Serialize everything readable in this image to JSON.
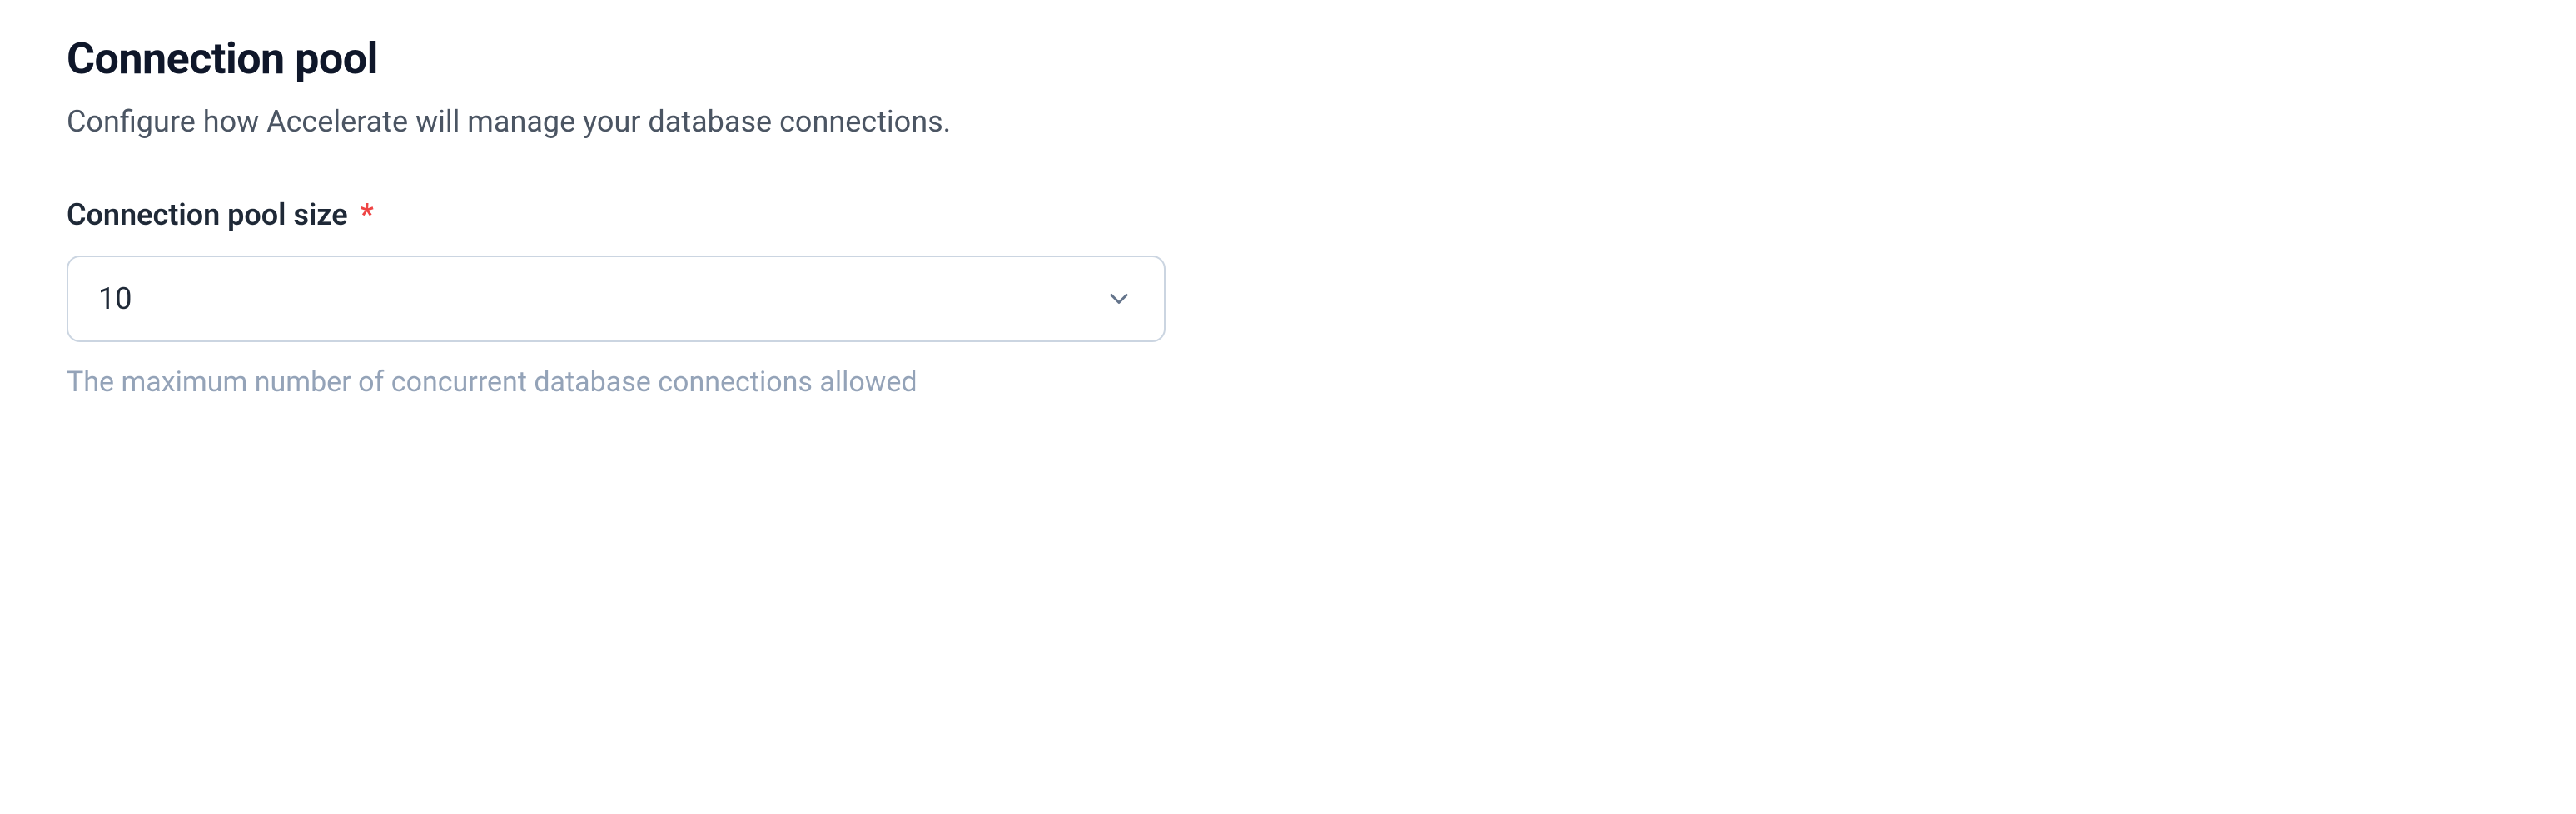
{
  "section": {
    "title": "Connection pool",
    "description": "Configure how Accelerate will manage your database connections."
  },
  "field": {
    "label": "Connection pool size",
    "required_marker": "*",
    "selected_value": "10",
    "help_text": "The maximum number of concurrent database connections allowed"
  }
}
